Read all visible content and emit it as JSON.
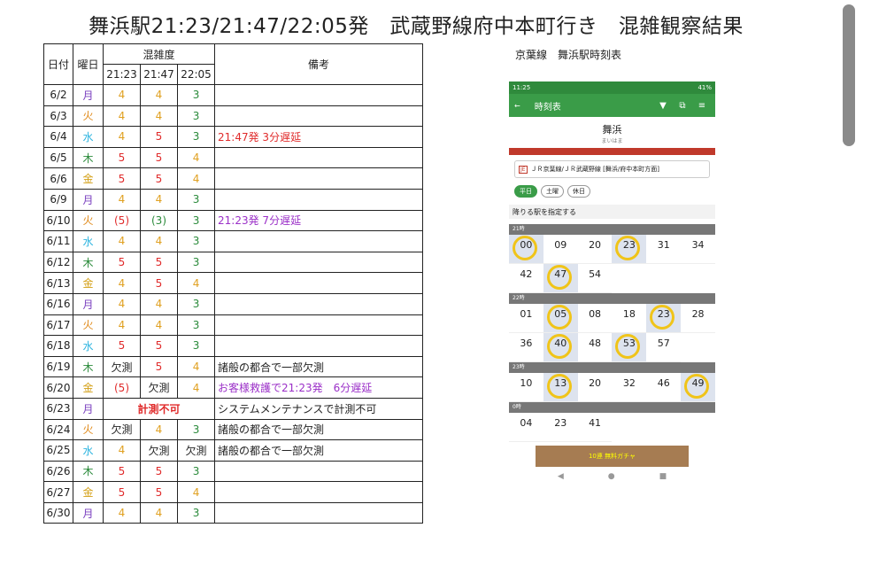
{
  "title": "舞浜駅21:23/21:47/22:05発　武蔵野線府中本町行き　混雑観察結果",
  "table": {
    "headers": {
      "date": "日付",
      "weekday": "曜日",
      "congestion": "混雑度",
      "times": [
        "21:23",
        "21:47",
        "22:05"
      ],
      "notes": "備考"
    },
    "rows": [
      {
        "date": "6/2",
        "day": "月",
        "v": [
          "4",
          "4",
          "3"
        ],
        "note": ""
      },
      {
        "date": "6/3",
        "day": "火",
        "v": [
          "4",
          "4",
          "3"
        ],
        "note": ""
      },
      {
        "date": "6/4",
        "day": "水",
        "v": [
          "4",
          "5",
          "3"
        ],
        "note": "21:47発 3分遅延"
      },
      {
        "date": "6/5",
        "day": "木",
        "v": [
          "5",
          "5",
          "4"
        ],
        "note": ""
      },
      {
        "date": "6/6",
        "day": "金",
        "v": [
          "5",
          "5",
          "4"
        ],
        "note": ""
      },
      {
        "date": "6/9",
        "day": "月",
        "v": [
          "4",
          "4",
          "3"
        ],
        "note": ""
      },
      {
        "date": "6/10",
        "day": "火",
        "v": [
          "(5)",
          "(3)",
          "3"
        ],
        "note": "21:23発 7分遅延"
      },
      {
        "date": "6/11",
        "day": "水",
        "v": [
          "4",
          "4",
          "3"
        ],
        "note": ""
      },
      {
        "date": "6/12",
        "day": "木",
        "v": [
          "5",
          "5",
          "3"
        ],
        "note": ""
      },
      {
        "date": "6/13",
        "day": "金",
        "v": [
          "4",
          "5",
          "4"
        ],
        "note": ""
      },
      {
        "date": "6/16",
        "day": "月",
        "v": [
          "4",
          "4",
          "3"
        ],
        "note": ""
      },
      {
        "date": "6/17",
        "day": "火",
        "v": [
          "4",
          "4",
          "3"
        ],
        "note": ""
      },
      {
        "date": "6/18",
        "day": "水",
        "v": [
          "5",
          "5",
          "3"
        ],
        "note": ""
      },
      {
        "date": "6/19",
        "day": "木",
        "v": [
          "欠測",
          "5",
          "4"
        ],
        "note": "諸般の都合で一部欠測"
      },
      {
        "date": "6/20",
        "day": "金",
        "v": [
          "(5)",
          "欠測",
          "4"
        ],
        "note": "お客様救護で21:23発　6分遅延"
      },
      {
        "date": "6/23",
        "day": "月",
        "v": [
          "計測不可",
          "",
          ""
        ],
        "note": "システムメンテナンスで計測不可"
      },
      {
        "date": "6/24",
        "day": "火",
        "v": [
          "欠測",
          "4",
          "3"
        ],
        "note": "諸般の都合で一部欠測"
      },
      {
        "date": "6/25",
        "day": "水",
        "v": [
          "4",
          "欠測",
          "欠測"
        ],
        "note": "諸般の都合で一部欠測"
      },
      {
        "date": "6/26",
        "day": "木",
        "v": [
          "5",
          "5",
          "3"
        ],
        "note": ""
      },
      {
        "date": "6/27",
        "day": "金",
        "v": [
          "5",
          "5",
          "4"
        ],
        "note": ""
      },
      {
        "date": "6/30",
        "day": "月",
        "v": [
          "4",
          "4",
          "3"
        ],
        "note": ""
      }
    ]
  },
  "colors": {
    "level5": "#e02b2b",
    "level4": "#e0a020",
    "level3": "#2a8a3a",
    "mon": "#7a3fbf",
    "tue": "#e08a1a",
    "wed": "#2fb5e0",
    "thu": "#2a8a3a",
    "fri": "#d4a017",
    "note_red": "#e02b2b",
    "note_purple": "#9b30c8",
    "note_black": "#222222"
  },
  "phone": {
    "caption": "京葉線　舞浜駅時刻表",
    "status_time": "11:25",
    "status_battery": "41%",
    "appbar_title": "時刻表",
    "station": "舞浜",
    "station_kana": "まいはま",
    "line": "ＪＲ京葉線/ＪＲ武蔵野線 [舞浜/府中本町方面]",
    "line_badge": "JE",
    "days": [
      "平日",
      "土曜",
      "休日"
    ],
    "filter": "降りる駅を指定する",
    "hours": [
      {
        "label": "21時",
        "mins": [
          [
            "00",
            true
          ],
          [
            "09",
            false
          ],
          [
            "20",
            false
          ],
          [
            "23",
            true
          ],
          [
            "31",
            false
          ],
          [
            "34",
            false
          ],
          [
            "42",
            false
          ],
          [
            "47",
            true
          ],
          [
            "54",
            false
          ]
        ]
      },
      {
        "label": "22時",
        "mins": [
          [
            "01",
            false
          ],
          [
            "05",
            true
          ],
          [
            "08",
            false
          ],
          [
            "18",
            false
          ],
          [
            "23",
            true
          ],
          [
            "28",
            false
          ],
          [
            "36",
            false
          ],
          [
            "40",
            true
          ],
          [
            "48",
            false
          ],
          [
            "53",
            true
          ],
          [
            "57",
            false
          ]
        ]
      },
      {
        "label": "23時",
        "mins": [
          [
            "10",
            false
          ],
          [
            "13",
            true
          ],
          [
            "20",
            false
          ],
          [
            "32",
            false
          ],
          [
            "46",
            false
          ],
          [
            "49",
            true
          ]
        ]
      },
      {
        "label": "0時",
        "mins": [
          [
            "04",
            false
          ],
          [
            "23",
            false
          ],
          [
            "41",
            false
          ]
        ]
      }
    ],
    "ad": "10連 無料ガチャ"
  }
}
